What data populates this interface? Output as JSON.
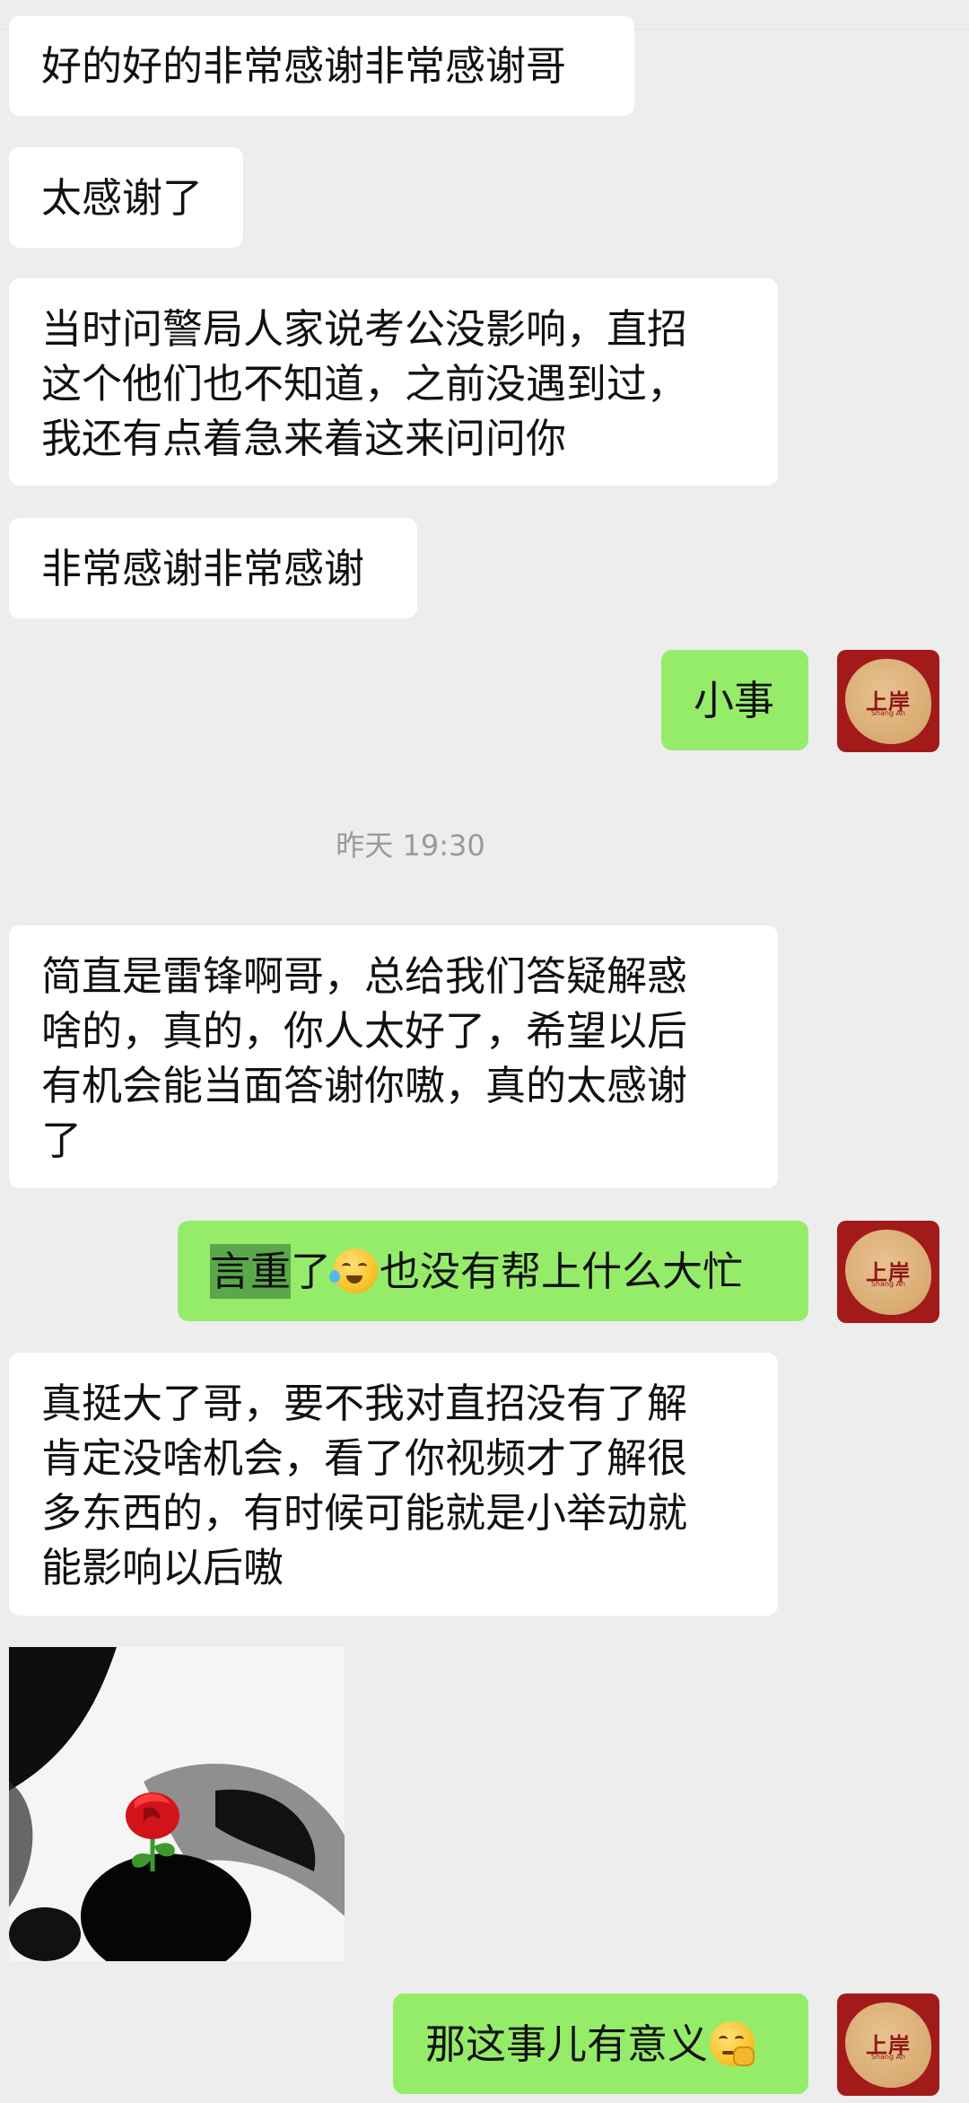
{
  "messages": {
    "m1": "好的好的非常感谢非常感谢哥",
    "m2": "太感谢了",
    "m3": [
      "当时问警局人家说考公没影响，直招",
      "这个他们也不知道，之前没遇到过，",
      "我还有点着急来着这来问问你"
    ],
    "m4": "非常感谢非常感谢",
    "m5": "小事",
    "timestamp": "昨天 19:30",
    "m6": [
      "简直是雷锋啊哥，总给我们答疑解惑",
      "啥的，真的，你人太好了，希望以后",
      "有机会能当面答谢你嗷，真的太感谢",
      "了"
    ],
    "m7_highlight": "言重",
    "m7_rest_a": "了",
    "m7_rest_b": "也没有帮上什么大忙",
    "m8": [
      "真挺大了哥，要不我对直招没有了解",
      "肯定没啥机会，看了你视频才了解很",
      "多东西的，有时候可能就是小举动就",
      "能影响以后嗷"
    ],
    "m9": "那这事儿有意义"
  },
  "avatar": {
    "main_text": "上岸",
    "sub_text": "Shang An"
  },
  "icons": {
    "m7_emoji": "laughing-crying-emoji-icon",
    "m9_emoji": "smirk-emoji-icon",
    "sticker": "rose-panda-sticker"
  },
  "colors": {
    "background": "#ededed",
    "incoming_bubble": "#ffffff",
    "outgoing_bubble": "#95ec69",
    "highlight": "#5aa84a",
    "avatar_red": "#a21a1a"
  }
}
